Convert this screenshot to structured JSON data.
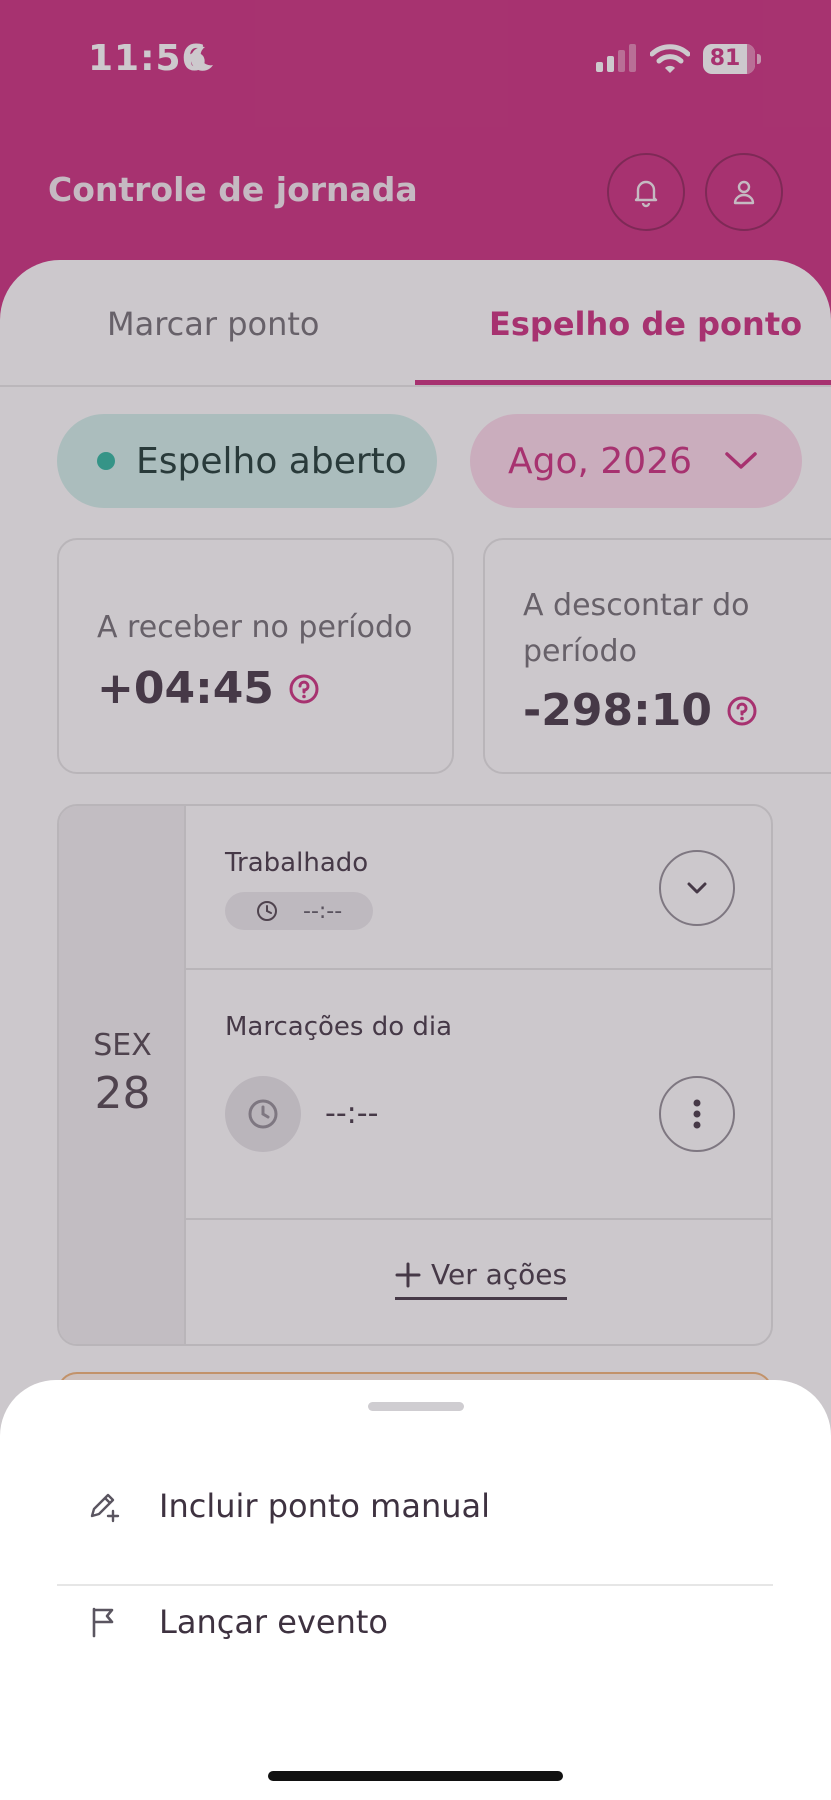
{
  "status_bar": {
    "time": "11:56",
    "battery": "81",
    "icons": [
      "moon-icon",
      "signal-icon",
      "wifi-icon",
      "battery-icon"
    ]
  },
  "header": {
    "title": "Controle de jornada",
    "notification_icon": "bell-icon",
    "profile_icon": "user-icon"
  },
  "tabs": [
    {
      "label": "Marcar ponto",
      "active": false
    },
    {
      "label": "Espelho de ponto",
      "active": true
    }
  ],
  "filters": {
    "status_label": "Espelho aberto",
    "month_label": "Ago, 2026"
  },
  "summary": {
    "receive": {
      "label": "A receber no período",
      "value": "+04:45"
    },
    "discount": {
      "label_line1": "A descontar do",
      "label_line2": "período",
      "value": "-298:10"
    }
  },
  "day_card": {
    "weekday": "SEX",
    "day": "28",
    "worked_label": "Trabalhado",
    "worked_time": "--:--",
    "marks_label": "Marcações do dia",
    "marks_time": "--:--",
    "actions_label": "Ver ações"
  },
  "sheet": {
    "items": [
      {
        "label": "Incluir ponto manual",
        "icon": "pencil-plus-icon"
      },
      {
        "label": "Lançar evento",
        "icon": "flag-icon"
      }
    ]
  },
  "colors": {
    "brand": "#c9287a",
    "open_chip_bg": "#cfeee8",
    "open_dot": "#26b39b",
    "month_chip_bg": "#fbd7e8"
  }
}
